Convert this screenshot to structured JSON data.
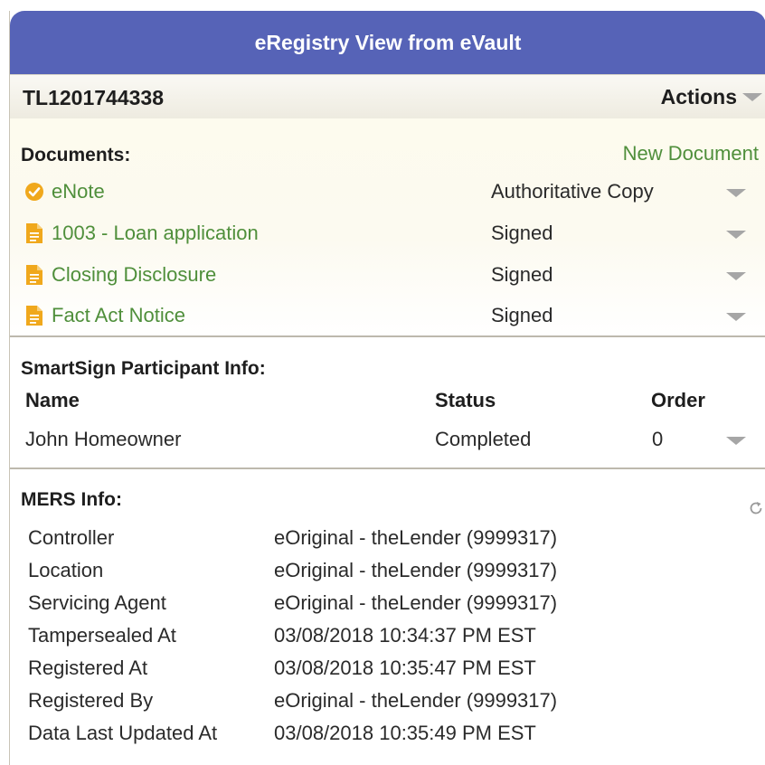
{
  "header": {
    "title": "eRegistry View from eVault"
  },
  "package": {
    "id": "TL1201744338",
    "actions_label": "Actions"
  },
  "documents": {
    "heading": "Documents:",
    "new_document_label": "New Document",
    "items": [
      {
        "name": "eNote",
        "status": "Authoritative Copy",
        "icon": "check-circle-icon"
      },
      {
        "name": "1003 - Loan application",
        "status": "Signed",
        "icon": "document-icon"
      },
      {
        "name": "Closing Disclosure",
        "status": "Signed",
        "icon": "document-icon"
      },
      {
        "name": "Fact Act Notice",
        "status": "Signed",
        "icon": "document-icon"
      }
    ]
  },
  "participants": {
    "heading": "SmartSign Participant Info:",
    "columns": {
      "name": "Name",
      "status": "Status",
      "order": "Order"
    },
    "rows": [
      {
        "name": "John Homeowner",
        "status": "Completed",
        "order": "0"
      }
    ]
  },
  "mers": {
    "heading": "MERS Info:",
    "fields": [
      {
        "label": "Controller",
        "value": "eOriginal - theLender (9999317)"
      },
      {
        "label": "Location",
        "value": "eOriginal - theLender (9999317)"
      },
      {
        "label": "Servicing Agent",
        "value": "eOriginal - theLender (9999317)"
      },
      {
        "label": "Tampersealed At",
        "value": "03/08/2018 10:34:37 PM EST"
      },
      {
        "label": "Registered At",
        "value": "03/08/2018 10:35:47 PM EST"
      },
      {
        "label": "Registered By",
        "value": "eOriginal - theLender (9999317)"
      },
      {
        "label": "Data Last Updated At",
        "value": "03/08/2018 10:35:49 PM EST"
      }
    ]
  },
  "colors": {
    "header_bg": "#5663b7",
    "link_green": "#4f8f3b",
    "icon_orange": "#f0a81c"
  }
}
